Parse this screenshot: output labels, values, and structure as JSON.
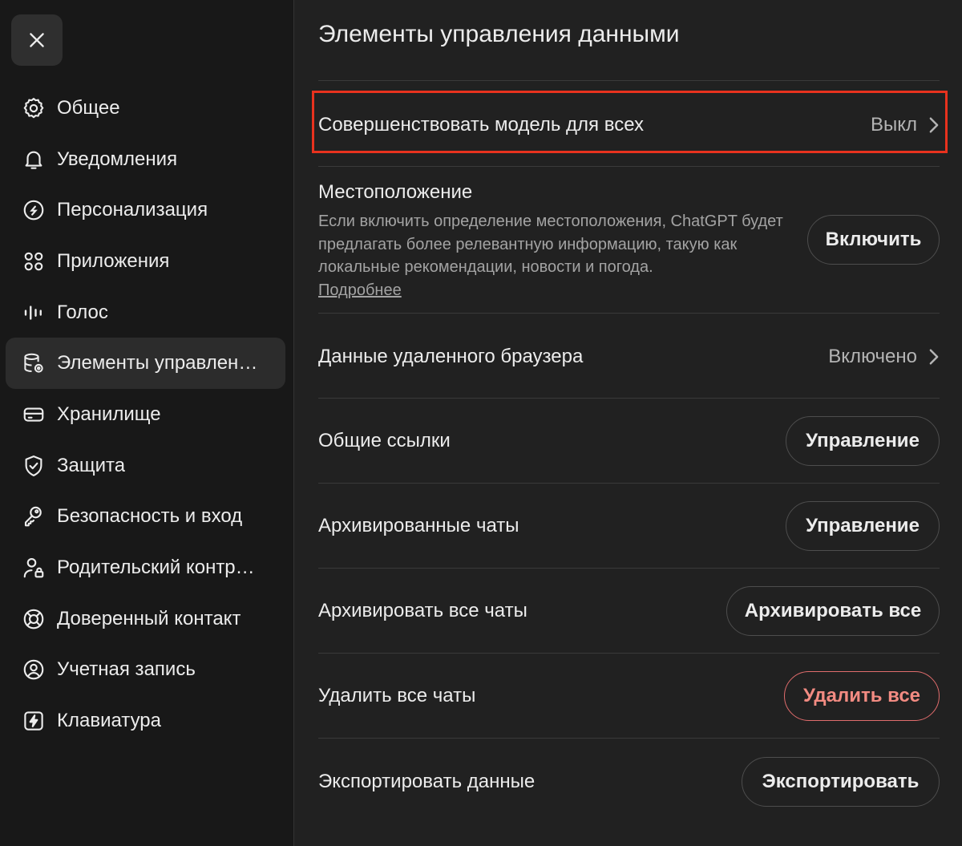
{
  "close": {
    "icon": "close-icon"
  },
  "sidebar": {
    "items": [
      {
        "label": "Общее",
        "icon": "gear-icon",
        "active": false
      },
      {
        "label": "Уведомления",
        "icon": "bell-icon",
        "active": false
      },
      {
        "label": "Персонализация",
        "icon": "personalization-icon",
        "active": false
      },
      {
        "label": "Приложения",
        "icon": "apps-grid-icon",
        "active": false
      },
      {
        "label": "Голос",
        "icon": "voice-waveform-icon",
        "active": false
      },
      {
        "label": "Элементы управлен…",
        "icon": "database-gear-icon",
        "active": true
      },
      {
        "label": "Хранилище",
        "icon": "storage-icon",
        "active": false
      },
      {
        "label": "Защита",
        "icon": "shield-check-icon",
        "active": false
      },
      {
        "label": "Безопасность и вход",
        "icon": "key-icon",
        "active": false
      },
      {
        "label": "Родительский контр…",
        "icon": "parent-lock-icon",
        "active": false
      },
      {
        "label": "Доверенный контакт",
        "icon": "lifebuoy-icon",
        "active": false
      },
      {
        "label": "Учетная запись",
        "icon": "user-circle-icon",
        "active": false
      },
      {
        "label": "Клавиатура",
        "icon": "lightning-icon",
        "active": false
      }
    ]
  },
  "main": {
    "title": "Элементы управления данными",
    "improve_model": {
      "label": "Совершенствовать модель для всех",
      "value": "Выкл"
    },
    "location": {
      "title": "Местоположение",
      "description": "Если включить определение местоположения, ChatGPT будет предлагать более релевантную информацию, такую как локальные рекомендации, новости и погода.",
      "link": "Подробнее",
      "button": "Включить"
    },
    "remote_browser": {
      "label": "Данные удаленного браузера",
      "value": "Включено"
    },
    "shared_links": {
      "label": "Общие ссылки",
      "button": "Управление"
    },
    "archived_chats": {
      "label": "Архивированные чаты",
      "button": "Управление"
    },
    "archive_all": {
      "label": "Архивировать все чаты",
      "button": "Архивировать все"
    },
    "delete_all": {
      "label": "Удалить все чаты",
      "button": "Удалить все"
    },
    "export": {
      "label": "Экспортировать данные",
      "button": "Экспортировать"
    }
  },
  "colors": {
    "highlight": "#e8321e",
    "danger": "#f28b82",
    "background": "#212121",
    "sidebar": "#181818"
  }
}
